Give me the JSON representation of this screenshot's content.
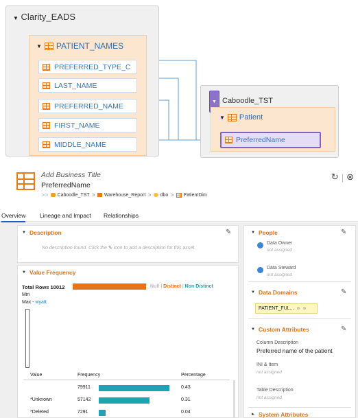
{
  "lineage": {
    "source_db": "Clarity_EADS",
    "source_table": "PATIENT_NAMES",
    "source_columns": [
      "PREFERRED_TYPE_C",
      "LAST_NAME",
      "PREFERRED_NAME",
      "FIRST_NAME",
      "MIDDLE_NAME"
    ],
    "target_db": "Caboodle_TST",
    "target_table": "Patient",
    "target_column": "PreferredName",
    "line_color": "#5aa0d8"
  },
  "asset": {
    "business_title": "Add Business Title",
    "name": "PreferredName",
    "breadcrumb": [
      "Caboodle_TST",
      "Warehouse_Report",
      "dbo",
      "PatientDim"
    ]
  },
  "tabs": [
    "Overview",
    "Lineage and Impact",
    "Relationships"
  ],
  "description": {
    "title": "Description",
    "empty_text_before": "No description found. Click the",
    "empty_text_after": "icon to add a description for this asset."
  },
  "value_frequency": {
    "title": "Value Frequency",
    "total_rows_label": "Total Rows",
    "total_rows": "10012",
    "legend_null": "Null",
    "legend_distinct": "Distinct",
    "legend_non_distinct": "Non Distinct",
    "min_label": "Min",
    "max_label": "Max -",
    "max_value": "wyatt",
    "columns": [
      "Value",
      "Frequency",
      "Percentage"
    ],
    "rows": [
      {
        "value": "",
        "frequency": "79911",
        "percentage": "0.43",
        "share": 0.43
      },
      {
        "value": "*Unknown",
        "frequency": "57142",
        "percentage": "0.31",
        "share": 0.31
      },
      {
        "value": "*Deleted",
        "frequency": "7291",
        "percentage": "0.04",
        "share": 0.04
      }
    ]
  },
  "people": {
    "title": "People",
    "data_owner_label": "Data Owner",
    "data_owner_value": "not assigned",
    "data_steward_label": "Data Steward",
    "data_steward_value": "not assigned"
  },
  "data_domains": {
    "title": "Data Domains",
    "tag": "PATIENT_FUL..."
  },
  "custom_attributes": {
    "title": "Custom Attributes",
    "column_description_label": "Column Description",
    "column_description_value": "Preferred name of the patient",
    "ini_item_label": "INI & Item",
    "ini_item_value": "not assigned",
    "table_description_label": "Table Description",
    "table_description_value": "not assigned"
  },
  "system_attributes": {
    "title": "System Attributes"
  },
  "colors": {
    "accent_orange": "#d9731a",
    "link_blue": "#1f5fbf",
    "teal_bar": "#1ea3b5",
    "target_purple": "#7d63bf"
  }
}
